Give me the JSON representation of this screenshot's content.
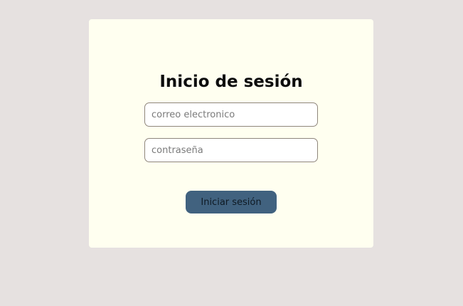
{
  "login": {
    "title": "Inicio de sesión",
    "email_placeholder": "correo electronico",
    "password_placeholder": "contraseña",
    "submit_label": "Iniciar sesión"
  },
  "colors": {
    "page_background": "#e6e1e0",
    "card_background": "#fffff0",
    "button_background": "#41627f"
  }
}
